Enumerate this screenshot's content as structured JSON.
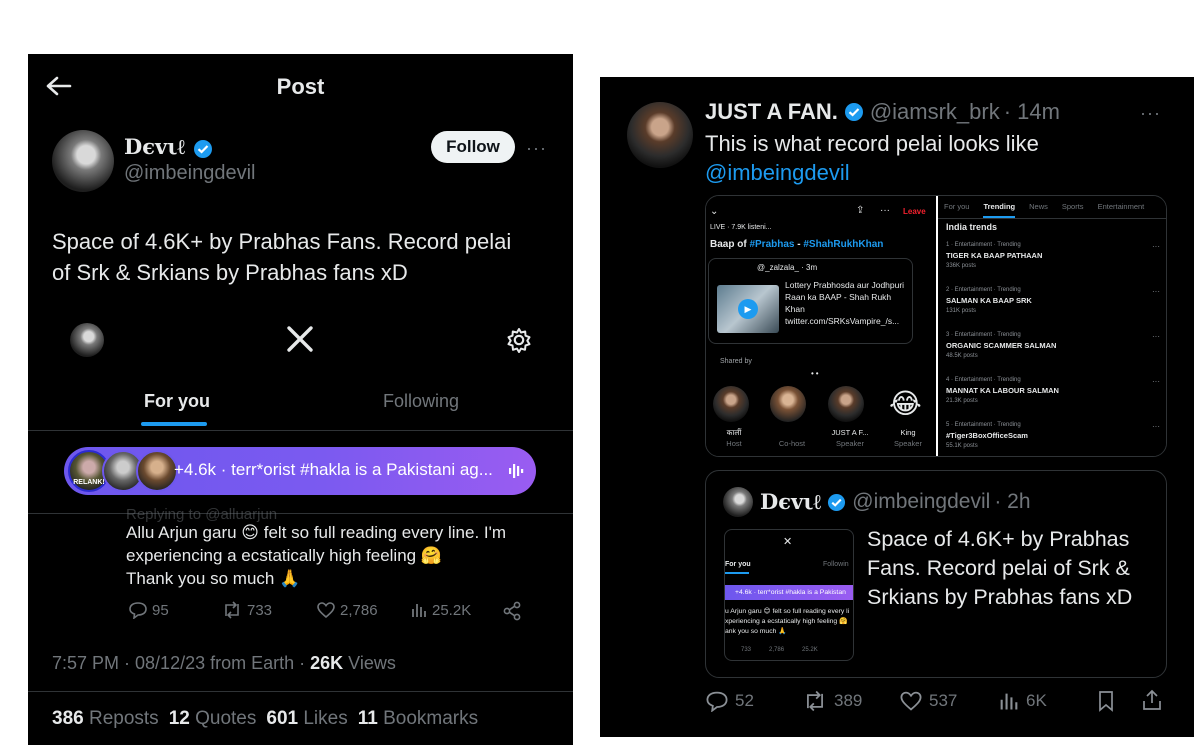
{
  "left": {
    "header_title": "Post",
    "author": {
      "name": "Dєvιℓ",
      "handle": "@imbeingdevil"
    },
    "follow_label": "Follow",
    "tweet_text_line1": "Space of 4.6K+ by Prabhas Fans. Record pelai",
    "tweet_text_line2": "of Srk & Srkians by Prabhas fans xD",
    "screenshot": {
      "tabs": [
        "For you",
        "Following"
      ],
      "space_bar_text": "+4.6k · terr*orist #hakla is a Pakistani ag...",
      "space_bar_avatar_label": "RELANK!",
      "replying_faded": "Replying to @alluarjun",
      "reply_lines": [
        "Allu Arjun garu 😊 felt so full reading every line. I'm",
        "experiencing a ecstatically high feeling 🤗",
        "Thank you so much 🙏"
      ],
      "metrics": {
        "replies": "95",
        "reposts": "733",
        "likes": "2,786",
        "views": "25.2K"
      }
    },
    "timestamp": "7:57 PM · 08/12/23 from Earth · ",
    "views_count": "26K",
    "views_label": " Views",
    "stats": [
      {
        "count": "386",
        "label": "Reposts"
      },
      {
        "count": "12",
        "label": "Quotes"
      },
      {
        "count": "601",
        "label": "Likes"
      },
      {
        "count": "11",
        "label": "Bookmarks"
      }
    ]
  },
  "right": {
    "author": {
      "name": "JUST A FAN.",
      "handle": "@iamsrk_brk",
      "time": "· 14m"
    },
    "text_line1": "This is what record pelai looks like",
    "mention": "@imbeingdevil",
    "space_shot": {
      "listening": "LIVE · 7.9K listeni...",
      "leave": "Leave",
      "title_prefix": "Baap of ",
      "title_tag1": "#Prabhas",
      "title_sep": " - ",
      "title_tag2": "#ShahRukhKhan",
      "pinned_user": "@_zalzala_ · 3m",
      "pinned_lines": [
        "Lottery Prabhosda aur Jodhpuri",
        "Raan ka BAAP - Shah Rukh Khan",
        "twitter.com/SRKsVampire_/s..."
      ],
      "shared_by": "Shared by",
      "speakers": [
        {
          "name": "कालीं",
          "role": "Host"
        },
        {
          "name": "",
          "role": "Co-host"
        },
        {
          "name": "JUST A F...",
          "role": "Speaker"
        },
        {
          "name": "King",
          "role": "Speaker"
        }
      ]
    },
    "trends_shot": {
      "tabs": [
        "For you",
        "Trending",
        "News",
        "Sports",
        "Entertainment"
      ],
      "heading": "India trends",
      "items": [
        {
          "meta": "1 · Entertainment · Trending",
          "title": "TIGER KA BAAP PATHAAN",
          "posts": "336K posts"
        },
        {
          "meta": "2 · Entertainment · Trending",
          "title": "SALMAN KA BAAP SRK",
          "posts": "131K posts"
        },
        {
          "meta": "3 · Entertainment · Trending",
          "title": "ORGANIC SCAMMER SALMAN",
          "posts": "48.5K posts"
        },
        {
          "meta": "4 · Entertainment · Trending",
          "title": "MANNAT KA LABOUR SALMAN",
          "posts": "21.3K posts"
        },
        {
          "meta": "5 · Entertainment · Trending",
          "title": "#Tiger3BoxOfficeScam",
          "posts": "55.1K posts"
        }
      ]
    },
    "quote": {
      "name": "Dєvιℓ",
      "handle": "@imbeingdevil",
      "time": "· 2h",
      "text_lines": [
        "Space of 4.6K+ by Prabhas",
        "Fans. Record pelai of Srk &",
        "Srkians by Prabhas fans xD"
      ],
      "thumb_tabs": [
        "For you",
        "Followin"
      ],
      "thumb_bar": "+4.6k · terr*orist #hakla is a Pakistan",
      "thumb_lines": [
        "u Arjun garu 😊 felt so full reading every li",
        "xperiencing a ecstatically high feeling 🤗",
        "ank you so much 🙏"
      ],
      "thumb_metrics": {
        "reposts": "733",
        "likes": "2,786",
        "views": "25.2K"
      }
    },
    "actions": {
      "replies": "52",
      "reposts": "389",
      "likes": "537",
      "views": "6K"
    }
  }
}
